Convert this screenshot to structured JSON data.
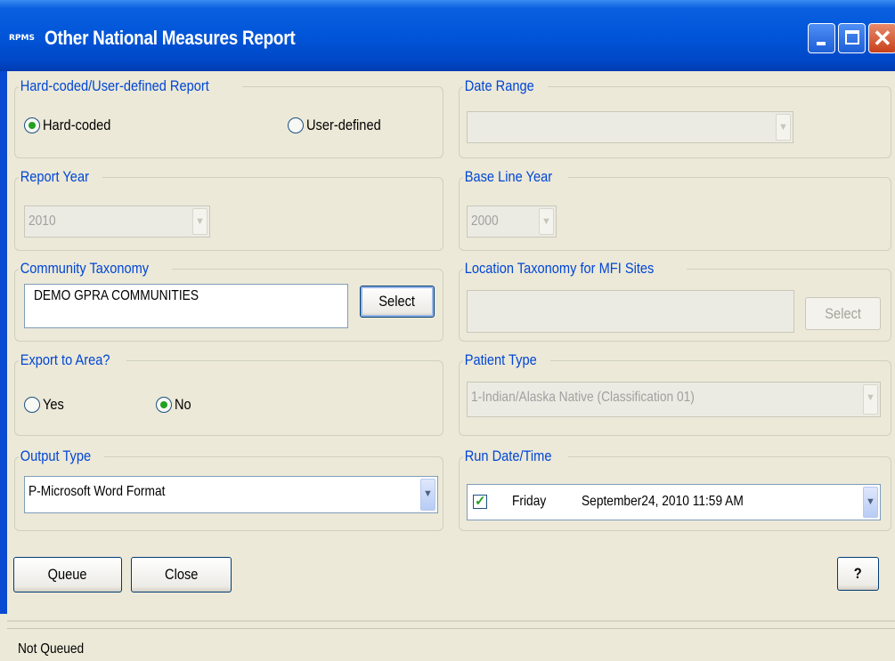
{
  "window": {
    "title": "Other National Measures Report",
    "app_icon_text": "RPMS",
    "buttons": [
      "minimize",
      "maximize",
      "close"
    ]
  },
  "report_type": {
    "legend": "Hard-coded/User-defined Report",
    "options": [
      "Hard-coded",
      "User-defined"
    ],
    "selected": "Hard-coded"
  },
  "date_range": {
    "legend": "Date Range",
    "value": ""
  },
  "report_year": {
    "legend": "Report Year",
    "value": "2010"
  },
  "base_line_year": {
    "legend": "Base Line Year",
    "value": "2000"
  },
  "community_taxonomy": {
    "legend": "Community Taxonomy",
    "value": "DEMO GPRA COMMUNITIES",
    "select_label": "Select"
  },
  "location_taxonomy": {
    "legend": "Location Taxonomy for MFI Sites",
    "value": "",
    "select_label": "Select"
  },
  "export_to_area": {
    "legend": "Export to Area?",
    "options": [
      "Yes",
      "No"
    ],
    "selected": "No"
  },
  "patient_type": {
    "legend": "Patient Type",
    "value": "1-Indian/Alaska Native (Classification 01)"
  },
  "output_type": {
    "legend": "Output Type",
    "value": "P-Microsoft Word Format"
  },
  "run_date_time": {
    "legend": "Run Date/Time",
    "checked": true,
    "day": "Friday",
    "date": "September24, 2010  11:59 AM"
  },
  "actions": {
    "queue_label": "Queue",
    "close_label": "Close",
    "help_label": "?"
  },
  "status": {
    "text": "Not Queued"
  },
  "colors": {
    "titlebar": "#0155d8",
    "legend_text": "#0046d5",
    "window_bg": "#ece9d8",
    "radio_dot": "#21a121"
  }
}
